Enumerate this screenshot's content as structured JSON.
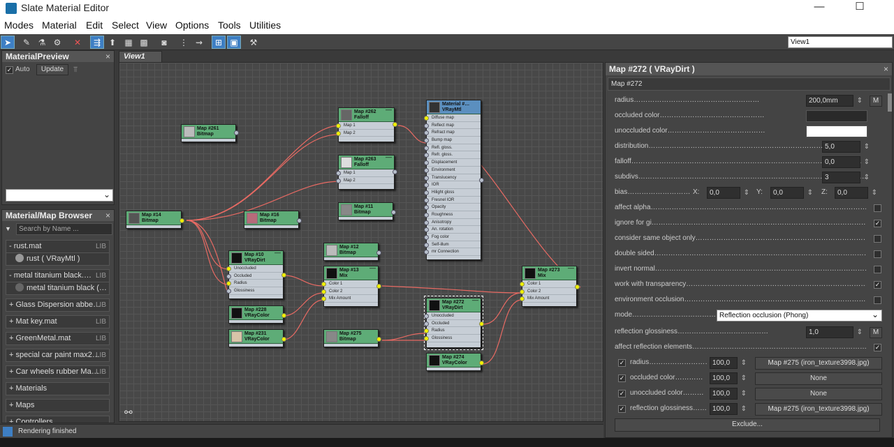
{
  "window": {
    "title": "Slate Material Editor",
    "minimize": "—",
    "maximize": "☐"
  },
  "menu": [
    "Modes",
    "Material",
    "Edit",
    "Select",
    "View",
    "Options",
    "Tools",
    "Utilities"
  ],
  "view_selector": "View1",
  "preview_panel": {
    "title": "MaterialPreview",
    "close": "×",
    "auto_label": "Auto",
    "auto_checked": true,
    "update_label": "Update"
  },
  "view_tab": "View1",
  "browser": {
    "title": "Material/Map Browser",
    "close": "×",
    "search_placeholder": "Search by Name ...",
    "items": [
      {
        "label": "- rust.mat",
        "lib": "LIB"
      },
      {
        "label": "rust  ( VRayMtl )",
        "lib": ""
      },
      {
        "label": "- metal titanium black.…",
        "lib": "LIB"
      },
      {
        "label": "metal titanium black  (…",
        "lib": ""
      },
      {
        "label": "+ Glass Dispersion abbe…",
        "lib": "LIB"
      },
      {
        "label": "+ Mat key.mat",
        "lib": "LIB"
      },
      {
        "label": "+ GreenMetal.mat",
        "lib": "LIB"
      },
      {
        "label": "+ special car paint max2…",
        "lib": "LIB"
      },
      {
        "label": "+ Car wheels rubber Ma…",
        "lib": "LIB"
      },
      {
        "label": "+ Materials",
        "lib": ""
      },
      {
        "label": "+ Maps",
        "lib": ""
      },
      {
        "label": "+ Controllers",
        "lib": ""
      }
    ]
  },
  "nodes": {
    "n261": {
      "name": "Map #261",
      "type": "Bitmap"
    },
    "n262": {
      "name": "Map #262",
      "type": "Falloff",
      "slots": [
        "Map 1",
        "Map 2"
      ]
    },
    "n263": {
      "name": "Map #263",
      "type": "Falloff",
      "slots": [
        "Map 1",
        "Map 2"
      ]
    },
    "n14": {
      "name": "Map #14",
      "type": "Bitmap"
    },
    "n16": {
      "name": "Map #16",
      "type": "Bitmap"
    },
    "n11": {
      "name": "Map #11",
      "type": "Bitmap"
    },
    "n10": {
      "name": "Map #10",
      "type": "VRayDirt",
      "slots": [
        "Unoccluded",
        "Occluded",
        "Radius",
        "Glossiness"
      ]
    },
    "n12": {
      "name": "Map #12",
      "type": "Bitmap"
    },
    "n13": {
      "name": "Map #13",
      "type": "Mix",
      "slots": [
        "Color 1",
        "Color 2",
        "Mix Amount"
      ]
    },
    "n228": {
      "name": "Map #228",
      "type": "VRayColor"
    },
    "n231": {
      "name": "Map #231",
      "type": "VRayColor"
    },
    "n275": {
      "name": "Map #275",
      "type": "Bitmap"
    },
    "n272": {
      "name": "Map #272",
      "type": "VRayDirt",
      "slots": [
        "Unoccluded",
        "Occluded",
        "Radius",
        "Glossiness"
      ]
    },
    "n274": {
      "name": "Map #274",
      "type": "VRayColor"
    },
    "n273": {
      "name": "Map #273",
      "type": "Mix",
      "slots": [
        "Color 1",
        "Color 2",
        "Mix Amount"
      ]
    },
    "mtl": {
      "name": "Material #…",
      "type": "VRayMtl",
      "slots": [
        "Diffuse map",
        "Reflect map",
        "Refract map",
        "Bump map",
        "Refl. gloss.",
        "Refr. gloss.",
        "Displacement",
        "Environment",
        "Translucency",
        "IOR",
        "Hilight gloss",
        "Fresnel IOR",
        "Opacity",
        "Roughness",
        "Anisotropy",
        "An. rotation",
        "Fog color",
        "Self-illum",
        "mr Connection"
      ]
    }
  },
  "props": {
    "title": "Map #272  ( VRayDirt )",
    "name": "Map #272",
    "radius": {
      "label": "radius………………………………………………",
      "value": "200,0mm",
      "m": "M"
    },
    "occluded": {
      "label": "occluded color………………………………………"
    },
    "unoccluded": {
      "label": "unoccluded color……………………………………"
    },
    "distribution": {
      "label": "distribution………………………………………………………………………………",
      "value": "5,0"
    },
    "falloff": {
      "label": "falloff………………………………………………………………………………………",
      "value": "0,0"
    },
    "subdivs": {
      "label": "subdivs………………………………………………………………………………………",
      "value": "3"
    },
    "bias": {
      "label": "bias………………………",
      "x": "X:",
      "xv": "0,0",
      "y": "Y:",
      "yv": "0,0",
      "z": "Z:",
      "zv": "0,0"
    },
    "checks": [
      {
        "label": "affect alpha……………………………………………………………………………………………………………",
        "checked": false
      },
      {
        "label": "ignore for gi……………………………………………………………………………………………………………",
        "checked": true
      },
      {
        "label": "consider same object only………………………………………………………………………………………",
        "checked": false
      },
      {
        "label": "double sided…………………………………………………………………………………………………………",
        "checked": false
      },
      {
        "label": "invert normal…………………………………………………………………………………………………………",
        "checked": false
      },
      {
        "label": "work with transparency…………………………………………………………………………………………",
        "checked": true
      },
      {
        "label": "environment occlusion……………………………………………………………………………………………",
        "checked": false
      }
    ],
    "mode": {
      "label": "mode………………………………………………",
      "value": "Reflection occlusion (Phong)"
    },
    "refl_gloss": {
      "label": "reflection glossiness…………………………………",
      "value": "1,0",
      "m": "M"
    },
    "affect_refl": {
      "label": "affect reflection elements………………………………………………………………………………………",
      "checked": true
    },
    "maps": [
      {
        "label": "radius…………………………",
        "value": "100,0",
        "map": "Map #275 (iron_texture3998.jpg)"
      },
      {
        "label": "occluded color…………",
        "value": "100,0",
        "map": "None"
      },
      {
        "label": "unoccluded color………",
        "value": "100,0",
        "map": "None"
      },
      {
        "label": "reflection glossiness……",
        "value": "100,0",
        "map": "Map #275 (iron_texture3998.jpg)"
      }
    ],
    "exclude": "Exclude..."
  },
  "status": "Rendering finished"
}
